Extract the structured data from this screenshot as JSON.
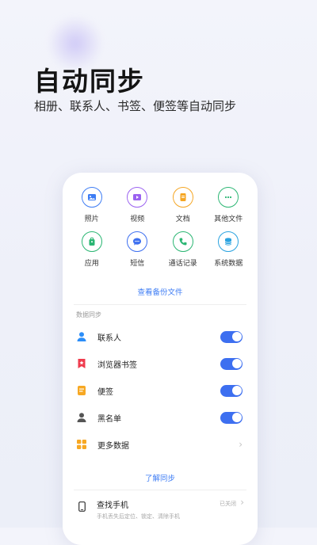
{
  "hero": {
    "title": "自动同步",
    "subtitle": "相册、联系人、书签、便签等自动同步"
  },
  "grid": [
    {
      "label": "照片",
      "icon": "photo-icon",
      "color": "#3d7cf4"
    },
    {
      "label": "视频",
      "icon": "video-icon",
      "color": "#9b62f0"
    },
    {
      "label": "文档",
      "icon": "document-icon",
      "color": "#f5a623"
    },
    {
      "label": "其他文件",
      "icon": "more-icon",
      "color": "#2bb673"
    },
    {
      "label": "应用",
      "icon": "app-icon",
      "color": "#2bb673"
    },
    {
      "label": "短信",
      "icon": "message-icon",
      "color": "#3d6ff0"
    },
    {
      "label": "通话记录",
      "icon": "phone-icon",
      "color": "#2bb673"
    },
    {
      "label": "系统数据",
      "icon": "database-icon",
      "color": "#2aa3e0"
    }
  ],
  "view_backup_label": "查看备份文件",
  "sync_section": {
    "label": "数据同步",
    "items": [
      {
        "label": "联系人",
        "icon": "contact-icon",
        "enabled": true
      },
      {
        "label": "浏览器书签",
        "icon": "bookmark-icon",
        "enabled": true
      },
      {
        "label": "便签",
        "icon": "note-icon",
        "enabled": true
      },
      {
        "label": "黑名单",
        "icon": "blacklist-icon",
        "enabled": true
      },
      {
        "label": "更多数据",
        "icon": "more-data-icon"
      }
    ]
  },
  "learn_sync_label": "了解同步",
  "find_phone": {
    "title": "查找手机",
    "description": "手机丢失后定位、锁定、清除手机",
    "status": "已关闭"
  },
  "colors": {
    "accent": "#3d7cf4",
    "toggle_on": "#3d6ff0"
  }
}
